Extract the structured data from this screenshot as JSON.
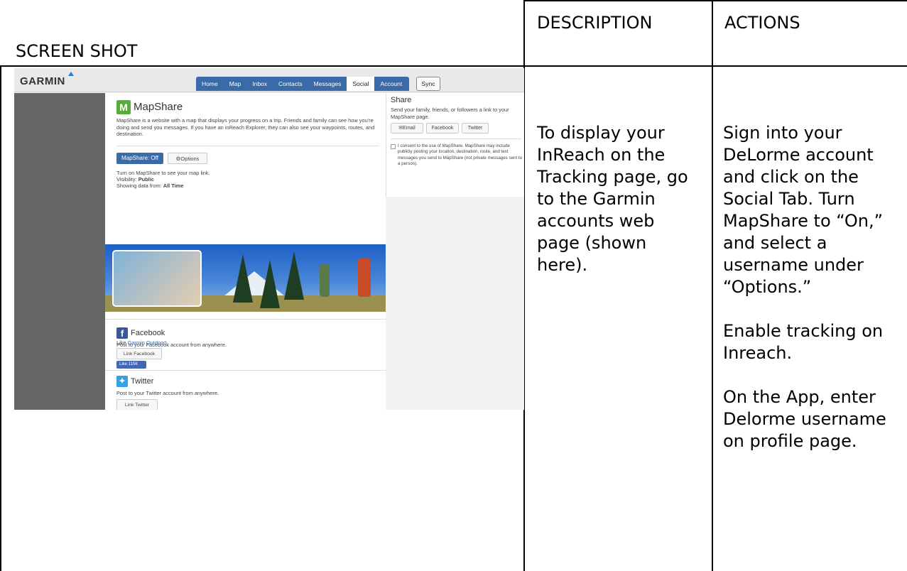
{
  "table": {
    "headers": {
      "screenshot": "SCREEN SHOT",
      "description": "DESCRIPTION",
      "actions": "ACTIONS"
    },
    "description_text": "To display your InReach on the Tracking page, go to the Garmin accounts web page (shown here).",
    "actions_paragraphs": [
      "Sign into your DeLorme account and click on the Social Tab. Turn MapShare to “On,” and select a username under “Options.”",
      "Enable tracking on Inreach.",
      "On the App, enter Delorme username on profile page."
    ]
  },
  "screenshot": {
    "logo": "GARMIN",
    "tabs": [
      "Home",
      "Map",
      "Inbox",
      "Contacts",
      "Messages",
      "Social",
      "Account"
    ],
    "active_tab": "Social",
    "sync_label": "Sync",
    "mapshare": {
      "badge": "M",
      "title": "MapShare",
      "description": "MapShare is a website with a map that displays your progress on a trip. Friends and family can see how you're doing and send you messages. If you have an inReach Explorer, they can also see your waypoints, routes, and destination.",
      "status_button": "MapShare: Off",
      "options_button": "⚙Options",
      "hint": "Turn on MapShare to see your map link.",
      "visibility_label": "Visibility:",
      "visibility_value": "Public",
      "showing_label": "Showing data from:",
      "showing_value": "All Time"
    },
    "share": {
      "title": "Share",
      "text": "Send your family, friends, or followers a link to your MapShare page.",
      "buttons": [
        "✉Email",
        "Facebook",
        "Twitter"
      ],
      "consent": "I consent to the use of MapShare. MapShare may include publicly posting your location, destination, route, and text messages you send to MapShare (not private messages sent to a person)."
    },
    "facebook": {
      "icon": "f",
      "title": "Facebook",
      "text": "Post to your Facebook account from anywhere.",
      "button": "Link Facebook",
      "like_prefix": "Like",
      "like_link": "Garmin Outdoor!",
      "like_button": "Like 115K"
    },
    "twitter": {
      "title": "Twitter",
      "text": "Post to your Twitter account from anywhere.",
      "button": "Link Twitter"
    },
    "colors": {
      "nav_blue": "#3a6aa8",
      "sidebar_gray": "#666666",
      "mapshare_green": "#5aac3a",
      "facebook_blue": "#3b5998",
      "twitter_blue": "#38a1e1"
    }
  }
}
